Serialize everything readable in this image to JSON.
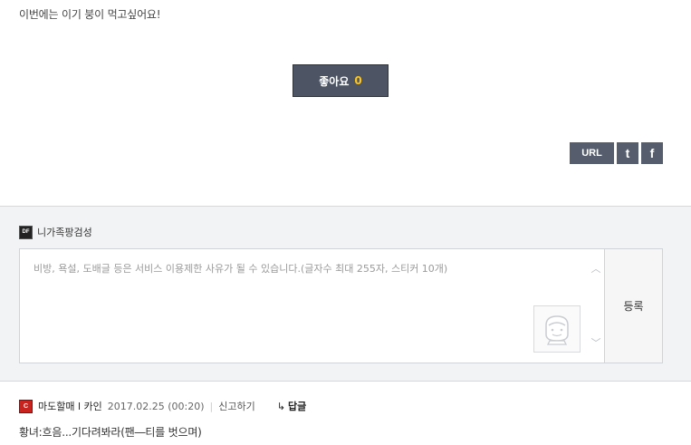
{
  "post": {
    "text": "이번에는 이기 붕이 먹고싶어요!"
  },
  "like": {
    "label": "좋아요",
    "count": "0"
  },
  "share": {
    "url_label": "URL",
    "twitter_label": "t",
    "facebook_label": "f"
  },
  "comment_form": {
    "username": "니가족팡검성",
    "placeholder": "비방, 욕설, 도배글 등은 서비스 이용제한 사유가 될 수 있습니다.(글자수 최대 255자, 스티커 10개)",
    "submit_label": "등록",
    "scroll_up_glyph": "︿",
    "scroll_down_glyph": "﹀"
  },
  "comments": [
    {
      "author": "마도할매 l 카인",
      "date": "2017.02.25 (00:20)",
      "separator": "|",
      "report_label": "신고하기",
      "reply_arrow": "↳",
      "reply_label": "답글",
      "body": "황녀:흐음...기다려봐라(팬―티를 벗으며)"
    }
  ],
  "colors": {
    "like_bg": "#4d5564",
    "like_count": "#ffc61a",
    "share_bg": "#565e6d",
    "comment_area_bg": "#f2f3f5"
  }
}
